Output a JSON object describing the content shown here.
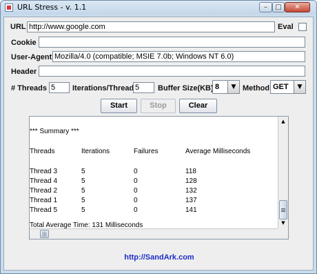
{
  "window": {
    "title": "URL Stress - v. 1.1",
    "controls": {
      "minimize": "–",
      "maximize": "□",
      "close": "✕"
    }
  },
  "form": {
    "url": {
      "label": "URL",
      "value": "http://www.google.com"
    },
    "eval": {
      "label": "Eval",
      "checked": false
    },
    "cookie": {
      "label": "Cookie",
      "value": ""
    },
    "user_agent": {
      "label": "User-Agent",
      "value": "Mozilla/4.0 (compatible; MSIE 7.0b; Windows NT 6.0)"
    },
    "header": {
      "label": "Header",
      "value": ""
    },
    "threads": {
      "label": "# Threads",
      "value": "5"
    },
    "iterations": {
      "label": "Iterations/Thread",
      "value": "5"
    },
    "buffer": {
      "label": "Buffer Size(KB)",
      "value": "8"
    },
    "method": {
      "label": "Method",
      "value": "GET"
    }
  },
  "buttons": {
    "start": "Start",
    "stop": "Stop",
    "clear": "Clear"
  },
  "output": {
    "summary_title": "*** Summary ***",
    "headers": [
      "Threads",
      "Iterations",
      "Failures",
      "Average Milliseconds"
    ],
    "rows": [
      [
        "Thread 3",
        "5",
        "0",
        "118"
      ],
      [
        "Thread 4",
        "5",
        "0",
        "128"
      ],
      [
        "Thread 2",
        "5",
        "0",
        "132"
      ],
      [
        "Thread 1",
        "5",
        "0",
        "137"
      ],
      [
        "Thread 5",
        "5",
        "0",
        "141"
      ]
    ],
    "total": "Total Average Time: 131 Milliseconds"
  },
  "scrollbar": {
    "up": "▲",
    "down": "▼",
    "h_thumb": "|||"
  },
  "footer_link": "http://SandArk.com"
}
